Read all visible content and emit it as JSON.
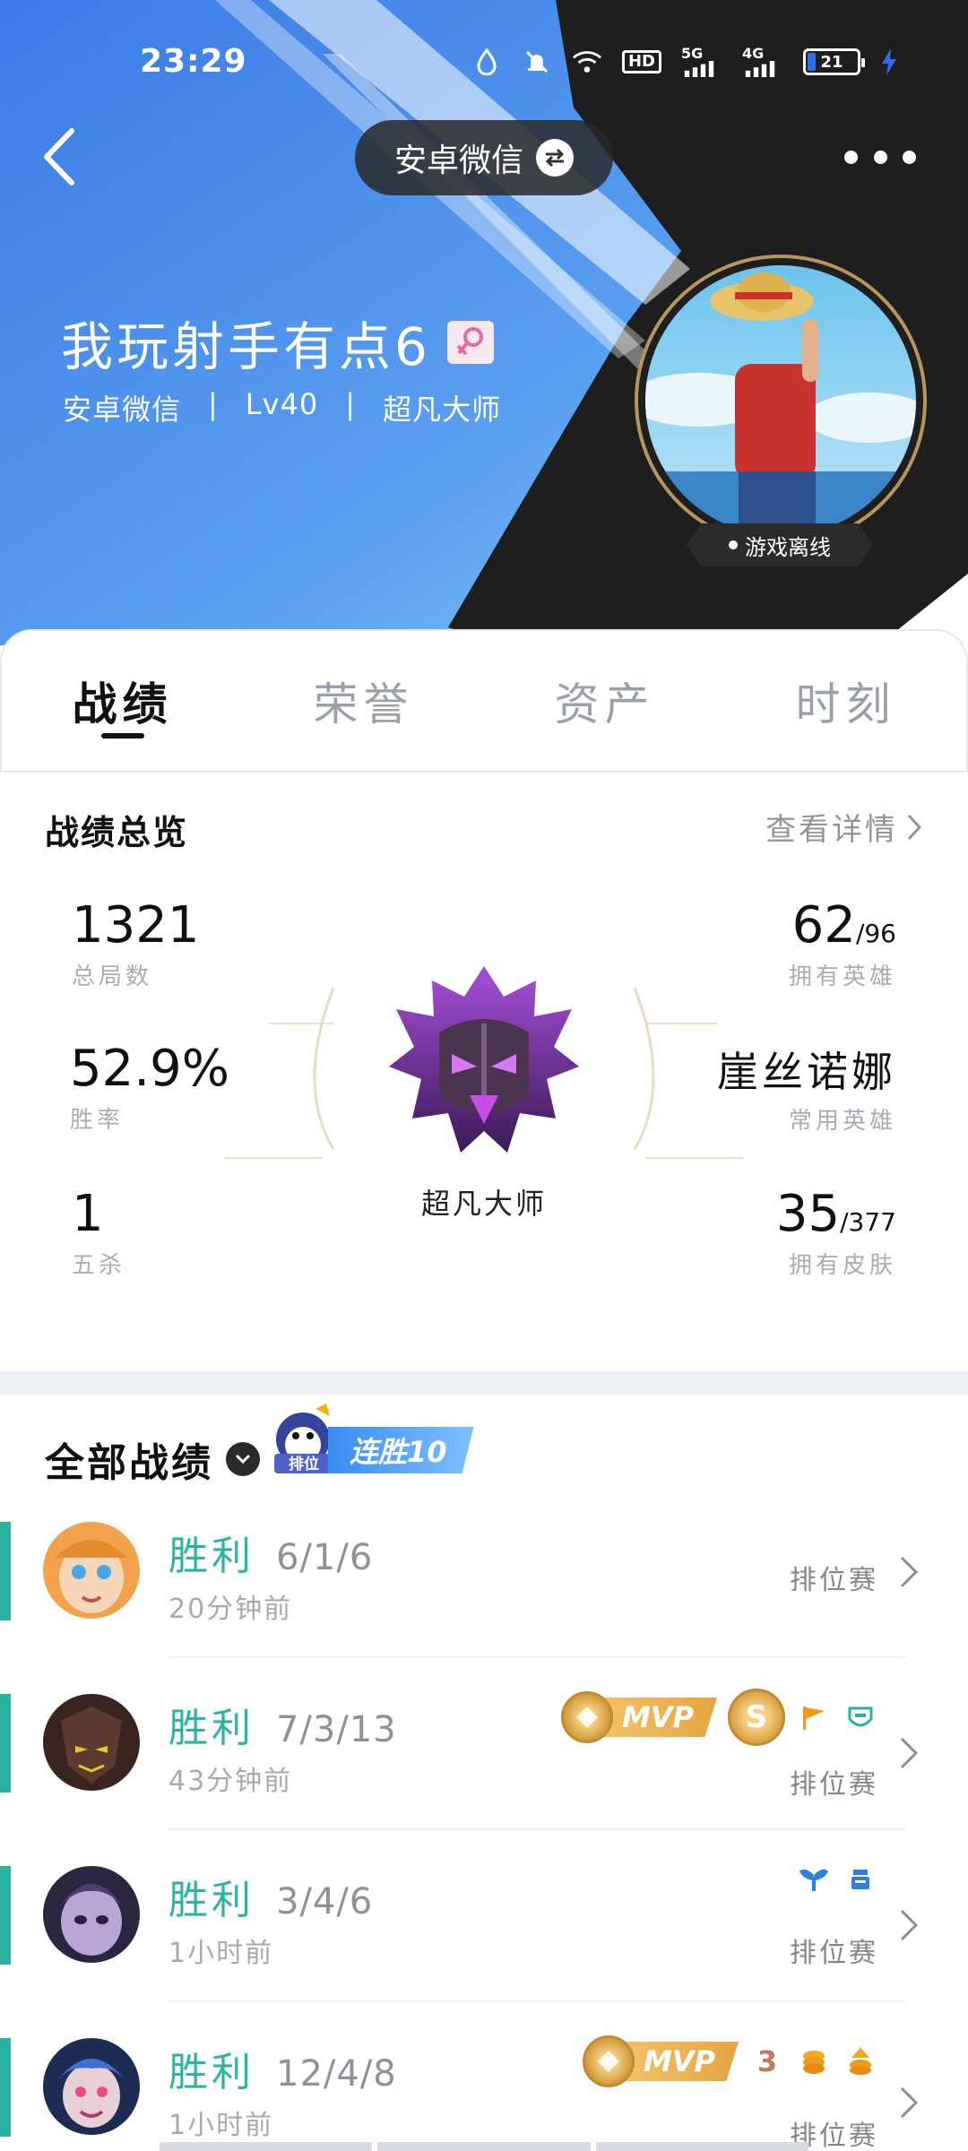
{
  "status": {
    "time": "23:29",
    "network_labels": [
      "HD",
      "5G",
      "4G"
    ],
    "battery": "21"
  },
  "header": {
    "account_switch_label": "安卓微信",
    "player_name": "我玩射手有点6",
    "meta": [
      "安卓微信",
      "Lv40",
      "超凡大师"
    ],
    "game_status": "游戏离线"
  },
  "tabs": [
    {
      "label": "战绩",
      "active": true
    },
    {
      "label": "荣誉",
      "active": false
    },
    {
      "label": "资产",
      "active": false
    },
    {
      "label": "时刻",
      "active": false
    }
  ],
  "overview": {
    "title": "战绩总览",
    "detail_link": "查看详情",
    "total_matches": {
      "value": "1321",
      "label": "总局数"
    },
    "win_rate": {
      "value": "52.9%",
      "label": "胜率"
    },
    "pentakills": {
      "value": "1",
      "label": "五杀"
    },
    "owned_heroes": {
      "value": "62",
      "total": "/96",
      "label": "拥有英雄"
    },
    "common_hero": {
      "value": "崖丝诺娜",
      "label": "常用英雄"
    },
    "owned_skins": {
      "value": "35",
      "total": "/377",
      "label": "拥有皮肤"
    },
    "rank": "超凡大师"
  },
  "records": {
    "title": "全部战绩",
    "streak_badge": {
      "queue": "排位",
      "text": "连胜10"
    },
    "matches": [
      {
        "result": "胜利",
        "kda": "6/1/6",
        "ago": "20分钟前",
        "mode": "排位赛"
      },
      {
        "result": "胜利",
        "kda": "7/3/13",
        "ago": "43分钟前",
        "mode": "排位赛",
        "mvp": "MVP",
        "s_badge": "S"
      },
      {
        "result": "胜利",
        "kda": "3/4/6",
        "ago": "1小时前",
        "mode": "排位赛"
      },
      {
        "result": "胜利",
        "kda": "12/4/8",
        "ago": "1小时前",
        "mode": "排位赛",
        "mvp": "MVP",
        "badge_num": "3"
      }
    ]
  },
  "colors": {
    "header_blue": "#3d7de8",
    "win_green": "#2bb3a3",
    "accent_bar": "#27b3a0",
    "mvp_gold": "#e6a540"
  }
}
